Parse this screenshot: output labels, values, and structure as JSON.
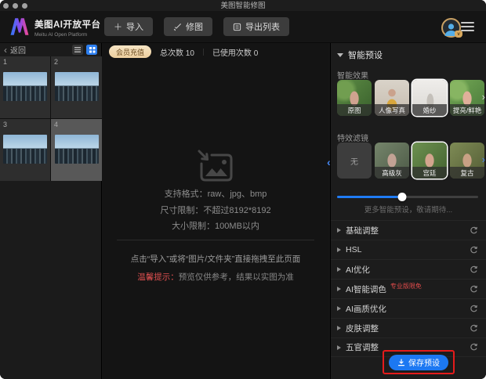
{
  "titlebar": {
    "title": "美图智能修图"
  },
  "header": {
    "brand_name": "美图AI开放平台",
    "brand_subtitle": "Meitu AI Open Platform",
    "import_label": "导入",
    "retouch_label": "修图",
    "export_label": "导出列表"
  },
  "sidebar": {
    "back_label": "返回",
    "thumbnails": [
      {
        "num": "1"
      },
      {
        "num": "2"
      },
      {
        "num": "3"
      },
      {
        "num": "4"
      }
    ]
  },
  "center": {
    "recharge_label": "会员充值",
    "total_label": "总次数 10",
    "separator": "｜",
    "used_label": "已使用次数 0",
    "format_line": "支持格式：raw、jpg、bmp",
    "dimension_line": "尺寸限制：不超过8192*8192",
    "filesize_line": "大小限制：100MB以内",
    "hint_line": "点击“导入”或将“图片/文件夹”直接拖拽至此页面",
    "tip_label": "温馨提示：",
    "tip_text": "预览仅供参考，结果以实图为准"
  },
  "panel": {
    "title": "智能预设",
    "effects_title": "智能效果",
    "effects": [
      {
        "label": "原图"
      },
      {
        "label": "人像写真"
      },
      {
        "label": "婚纱"
      },
      {
        "label": "提亮/鲜艳"
      }
    ],
    "filters_title": "特效滤镜",
    "filters": [
      {
        "label": "无"
      },
      {
        "label": "高级灰"
      },
      {
        "label": "宫廷"
      },
      {
        "label": "复古"
      }
    ],
    "slider_percent": 46,
    "more_label": "更多智能预设，敬请期待...",
    "sections": [
      {
        "label": "基础调整"
      },
      {
        "label": "HSL"
      },
      {
        "label": "AI优化"
      },
      {
        "label": "AI智能调色",
        "badge": "专业版限免"
      },
      {
        "label": "AI画质优化"
      },
      {
        "label": "皮肤调整"
      },
      {
        "label": "五官调整"
      }
    ],
    "save_label": "保存预设"
  },
  "colors": {
    "accent_blue": "#1f7bf4",
    "member_gold": "#f2d9ae",
    "badge_red": "#e14b4b",
    "annotation_red": "#e41b1b"
  }
}
